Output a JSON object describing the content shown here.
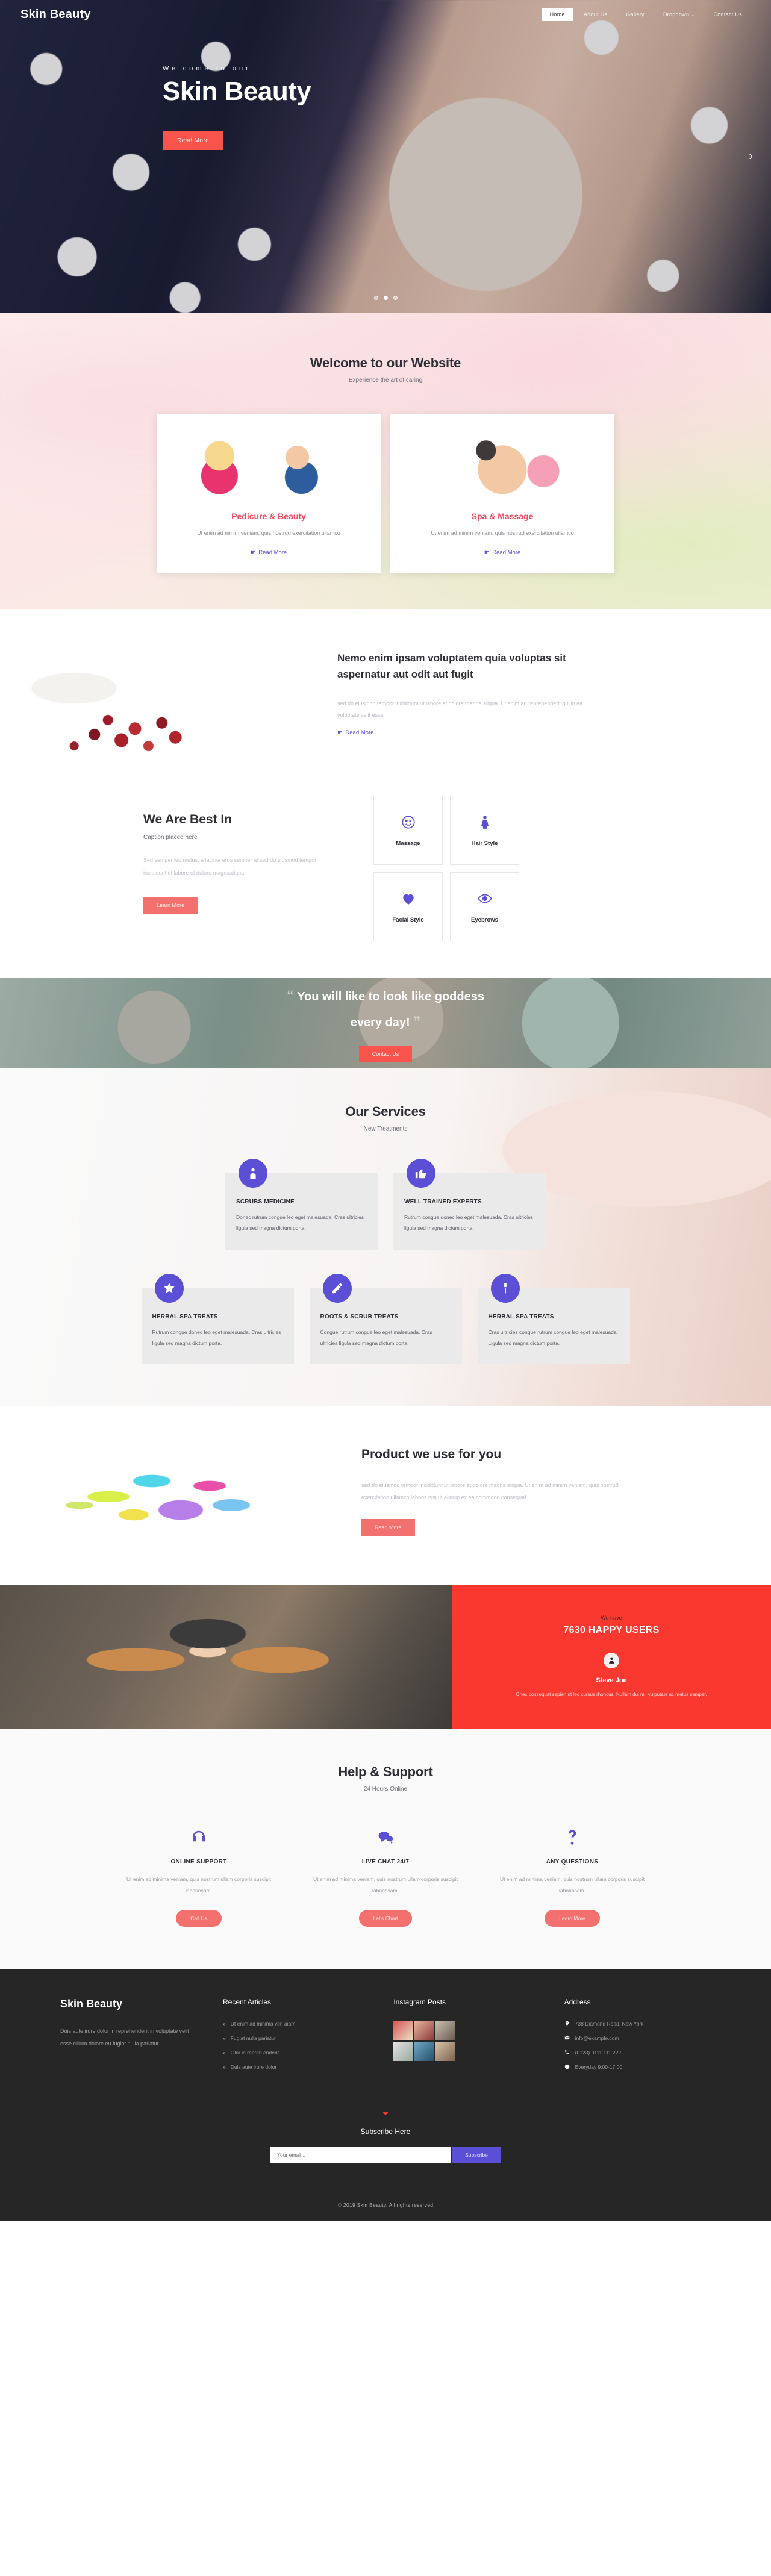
{
  "brand": "Skin Beauty",
  "nav": {
    "items": [
      {
        "label": "Home",
        "active": true
      },
      {
        "label": "About Us",
        "active": false
      },
      {
        "label": "Gallery",
        "active": false
      },
      {
        "label": "Dropdown",
        "active": false,
        "caret": "⌄"
      },
      {
        "label": "Contact Us",
        "active": false
      }
    ]
  },
  "hero": {
    "kicker": "Welcome to our",
    "title": "Skin Beauty",
    "button": "Read More",
    "arrow": "›",
    "dots": 3,
    "active_dot": 1
  },
  "welcome": {
    "title": "Welcome to our Website",
    "subtitle": "Experience the art of caring",
    "cards": [
      {
        "title": "Pedicure & Beauty",
        "text": "Ut enim ad minim veniam, quis nostrud exercitation ullamco",
        "link": "Read More"
      },
      {
        "title": "Spa & Massage",
        "text": "Ut enim ad minim veniam, quis nostrud exercitation ullamco",
        "link": "Read More"
      }
    ]
  },
  "nemo": {
    "heading": "Nemo enim ipsam voluptatem quia voluptas sit aspernatur aut odit aut fugit",
    "body": "sed do eiusmod tempor incididunt ut labore et dolore magna aliqua. Ut enim ad reprehenderit qui in ea voluptate velit esse",
    "link": "Read More"
  },
  "best": {
    "title": "We Are Best In",
    "caption": "Caption placed here",
    "body": "Sed semper leo metus, a lacinia eros semper at sed do eiusmod tempor incididunt ut labore et dolore magnaaliqua.",
    "button": "Learn More",
    "tiles": [
      {
        "label": "Massage",
        "icon": "smiley-icon"
      },
      {
        "label": "Hair Style",
        "icon": "woman-icon"
      },
      {
        "label": "Facial Style",
        "icon": "heart-icon"
      },
      {
        "label": "Eyebrows",
        "icon": "eye-icon"
      }
    ]
  },
  "quote": {
    "open": "“",
    "line1": "You will like to look like goddess",
    "line2": "every day!",
    "close": "”",
    "button": "Contact Us"
  },
  "services": {
    "title": "Our Services",
    "subtitle": "New Treatments",
    "row1": [
      {
        "title": "SCRUBS MEDICINE",
        "text": "Donec rutrum congue leo eget malesuada. Cras ultricies ligula sed magna dictum porta.",
        "icon": "doctor-icon"
      },
      {
        "title": "WELL TRAINED EXPERTS",
        "text": "Rutrum congue donec leo eget malesuada. Cras ultricies ligula sed magna dictum porta.",
        "icon": "thumbs-up-icon"
      }
    ],
    "row2": [
      {
        "title": "HERBAL SPA TREATS",
        "text": "Rutrum congue donec leo eget malesuada. Cras ultricies ligula sed magna dictum porta.",
        "icon": "star-icon"
      },
      {
        "title": "ROOTS & SCRUB TREATS",
        "text": "Congue rutrum congue leo eget malesuada. Cras ultricies ligula sed magna dictum porta.",
        "icon": "pen-icon"
      },
      {
        "title": "HERBAL SPA TREATS",
        "text": "Cras ultricies congue rutrum congue leo eget malesuada. Ligula sed magna dictum porta.",
        "icon": "tool-icon"
      }
    ]
  },
  "product": {
    "title": "Product we use for you",
    "body": "sed do eiusmod tempor incididunt ut labore et dolore magna aliqua. Ut enim ad minim veniam, quis nostrud exercitation ullamco laboris nisi ut aliquip ex ea commodo consequat.",
    "button": "Read More"
  },
  "happy": {
    "we_have": "We have",
    "count": "7630 HAPPY USERS",
    "name": "Steve Joe",
    "quote": "Onec consequat sapien ut leo cursus rhoncus. Nullam dui mi, vulputate ac metus semper."
  },
  "help": {
    "title": "Help & Support",
    "subtitle": "24 Hours Online",
    "columns": [
      {
        "title": "ONLINE SUPPORT",
        "text": "Ut enim ad minima veniam, quis nostrum ullam corporis suscipit laboriosam.",
        "button": "Call Us",
        "icon": "headphones-icon"
      },
      {
        "title": "LIVE CHAT 24/7",
        "text": "Ut enim ad minima veniam, quis nostrum ullam corporis suscipit laboriosam.",
        "button": "Let's Chart",
        "icon": "chat-bubble-icon"
      },
      {
        "title": "ANY QUESTIONS",
        "text": "Ut enim ad minima veniam, quis nostrum ullam corporis suscipit laboriosam.",
        "button": "Learn More",
        "icon": "question-mark-icon"
      }
    ]
  },
  "footer": {
    "brand": "Skin Beauty",
    "brand_text": "Duis aute irure dolor in reprehenderit in voluptate velit esse cillum dolore eu fugiat nulla pariatur.",
    "articles_title": "Recent Articles",
    "articles": [
      "Ut enim ad minima ven aiam",
      "Fugiat nulla pariatur",
      "Olor in repreh enderit",
      "Duis aute irure dolor"
    ],
    "instagram_title": "Instagram Posts",
    "address_title": "Address",
    "address": [
      {
        "icon": "location-pin-icon",
        "text": "738 Diamond Road, New York"
      },
      {
        "icon": "envelope-icon",
        "text": "info@example.com"
      },
      {
        "icon": "phone-icon",
        "text": "(0123) 0111 111 222"
      },
      {
        "icon": "clock-icon",
        "text": "Everyday 9:00-17:00"
      }
    ],
    "subscribe_title": "Subscribe Here",
    "subscribe_placeholder": "Your email...",
    "subscribe_button": "Subscribe",
    "copyright": "© 2019 Skin Beauty. All rights reserved"
  },
  "colors": {
    "accent_red": "#f9544b",
    "accent_purple": "#5b4fd6",
    "soft_red": "#f2716f",
    "happy_bg": "#f9392f",
    "footer_bg": "#262626"
  }
}
